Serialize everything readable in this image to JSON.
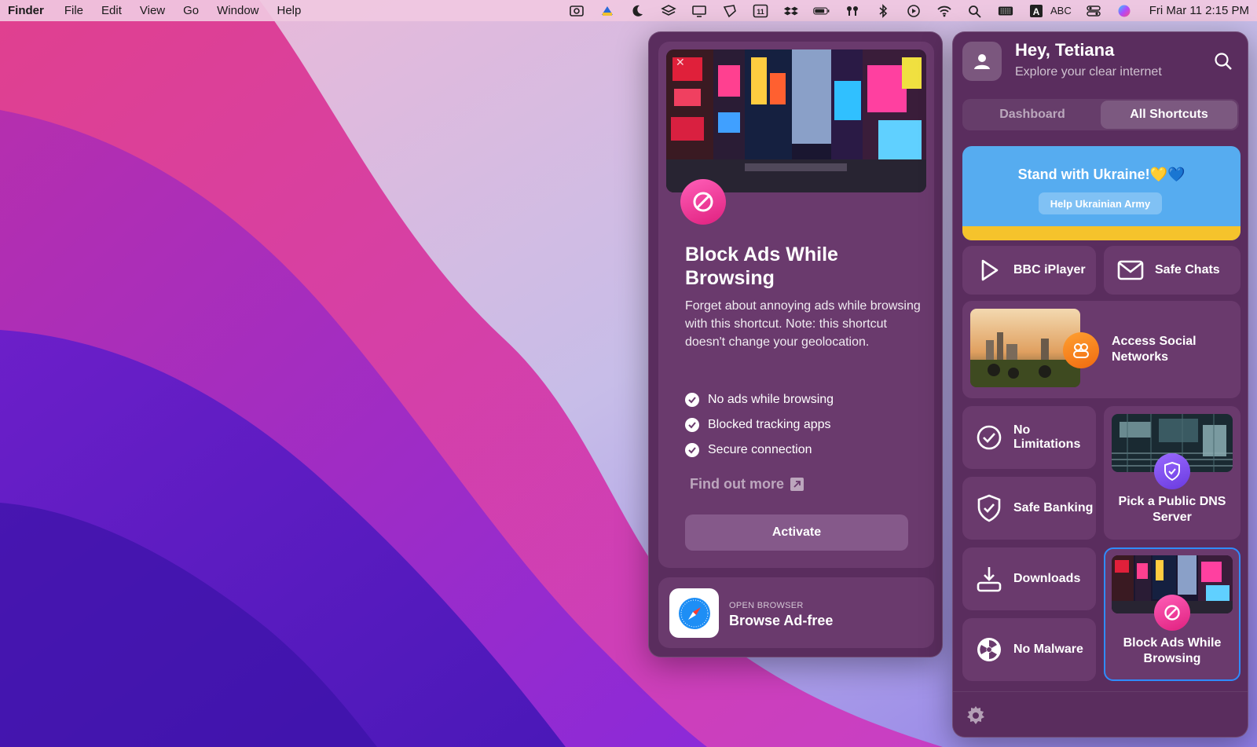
{
  "menubar": {
    "app_name": "Finder",
    "menus": [
      "File",
      "Edit",
      "View",
      "Go",
      "Window",
      "Help"
    ],
    "input_source": "ABC",
    "clock": "Fri Mar 11  2:15 PM",
    "calendar_day": "11"
  },
  "detail": {
    "title": "Block Ads While Browsing",
    "description": "Forget about annoying ads while browsing with this shortcut. Note: this shortcut doesn't change your geolocation.",
    "features": [
      "No ads while browsing",
      "Blocked tracking apps",
      "Secure connection"
    ],
    "find_more": "Find out more",
    "activate_label": "Activate",
    "browse_caption": "OPEN BROWSER",
    "browse_label": "Browse Ad-free"
  },
  "shortcuts": {
    "greeting": "Hey, Tetiana",
    "subtitle": "Explore your clear internet",
    "tabs": [
      {
        "label": "Dashboard",
        "active": false
      },
      {
        "label": "All Shortcuts",
        "active": true
      }
    ],
    "banner": {
      "title": "Stand with Ukraine!💛💙",
      "button": "Help Ukrainian Army"
    },
    "items": {
      "bbc": "BBC iPlayer",
      "safe_chats": "Safe Chats",
      "social": "Access Social Networks",
      "no_limitations": "No Limitations",
      "dns": "Pick a Public DNS Server",
      "safe_banking": "Safe Banking",
      "downloads": "Downloads",
      "no_malware": "No Malware",
      "block_ads": "Block Ads While Browsing"
    }
  },
  "colors": {
    "panel_bg": "#5a2d5e",
    "tile_bg": "#6a3a6d",
    "accent_pink": "#ff3fa6",
    "selected_border": "#2f8cff",
    "ukraine_blue": "#56acf0",
    "ukraine_yellow": "#f5c32c"
  }
}
